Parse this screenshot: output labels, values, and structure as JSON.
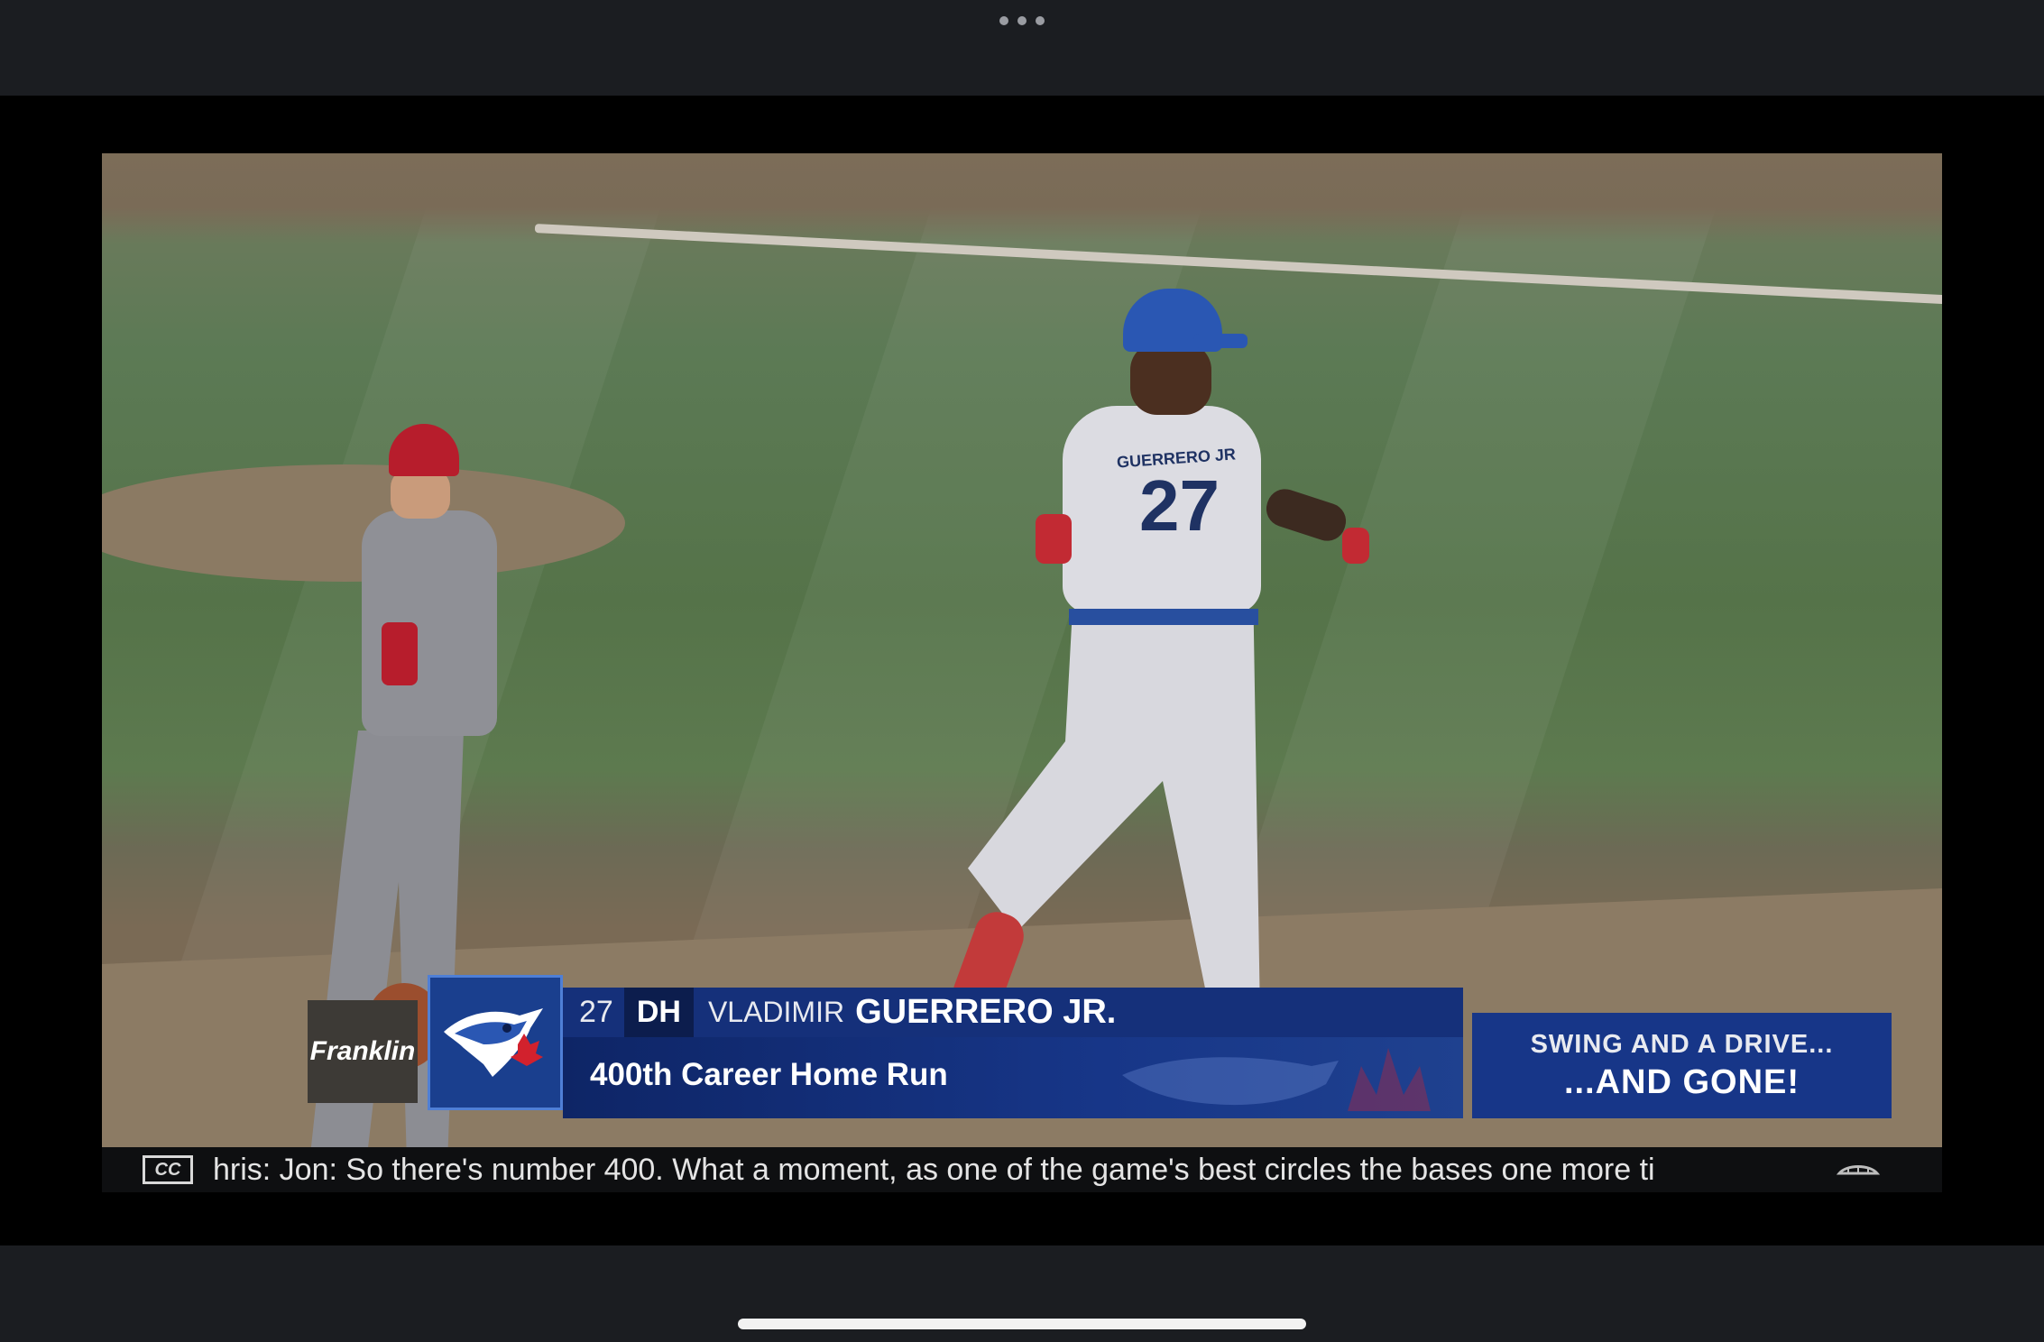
{
  "top_bar": {
    "menu_icon": "more-dots-icon"
  },
  "overlay": {
    "sponsor": "Franklin",
    "team_logo_icon": "blue-jays-logo-icon",
    "player": {
      "number": "27",
      "position": "DH",
      "first_name": "VLADIMIR",
      "last_name": "GUERRERO JR."
    },
    "subtitle": "400th Career Home Run",
    "callout_line1": "SWING AND A DRIVE...",
    "callout_line2": "...AND GONE!"
  },
  "scene": {
    "batter_jersey_number": "27",
    "batter_jersey_name": "GUERRERO JR"
  },
  "captions": {
    "cc_label": "CC",
    "text": "hris: Jon: So there's number 400. What a moment, as one of the game's best circles the bases one more ti",
    "end_icon": "caption-settings-icon"
  },
  "colors": {
    "overlay_blue": "#15307a",
    "overlay_dark": "#0c1d4d",
    "maple_leaf_red": "#d2212d"
  }
}
